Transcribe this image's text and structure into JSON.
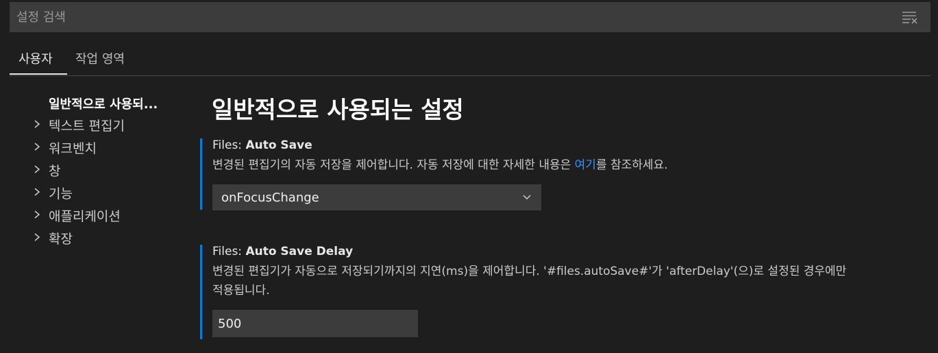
{
  "search": {
    "placeholder": "설정 검색",
    "value": ""
  },
  "tabs": [
    {
      "label": "사용자",
      "active": true
    },
    {
      "label": "작업 영역",
      "active": false
    }
  ],
  "toc": {
    "selected": "일반적으로 사용되...",
    "items": [
      {
        "label": "텍스트 편집기"
      },
      {
        "label": "워크벤치"
      },
      {
        "label": "창"
      },
      {
        "label": "기능"
      },
      {
        "label": "애플리케이션"
      },
      {
        "label": "확장"
      }
    ]
  },
  "section_title": "일반적으로 사용되는 설정",
  "settings": [
    {
      "category": "Files: ",
      "name": "Auto Save",
      "desc_before": "변경된 편집기의 자동 저장을 제어합니다. 자동 저장에 대한 자세한 내용은 ",
      "desc_link": "여기",
      "desc_after": "를 참조하세요.",
      "value": "onFocusChange"
    },
    {
      "category": "Files: ",
      "name": "Auto Save Delay",
      "desc_line1": "변경된 편집기가 자동으로 저장되기까지의 지연(ms)을 제어합니다. '#files.autoSave#'가 'afterDelay'(으)로 설정된 경우에만",
      "desc_line2": "적용됩니다.",
      "value": "500"
    }
  ],
  "colors": {
    "accent": "#007fd4",
    "link": "#3794ff",
    "background": "#1e1e1e",
    "input_bg": "#3c3c3c"
  }
}
